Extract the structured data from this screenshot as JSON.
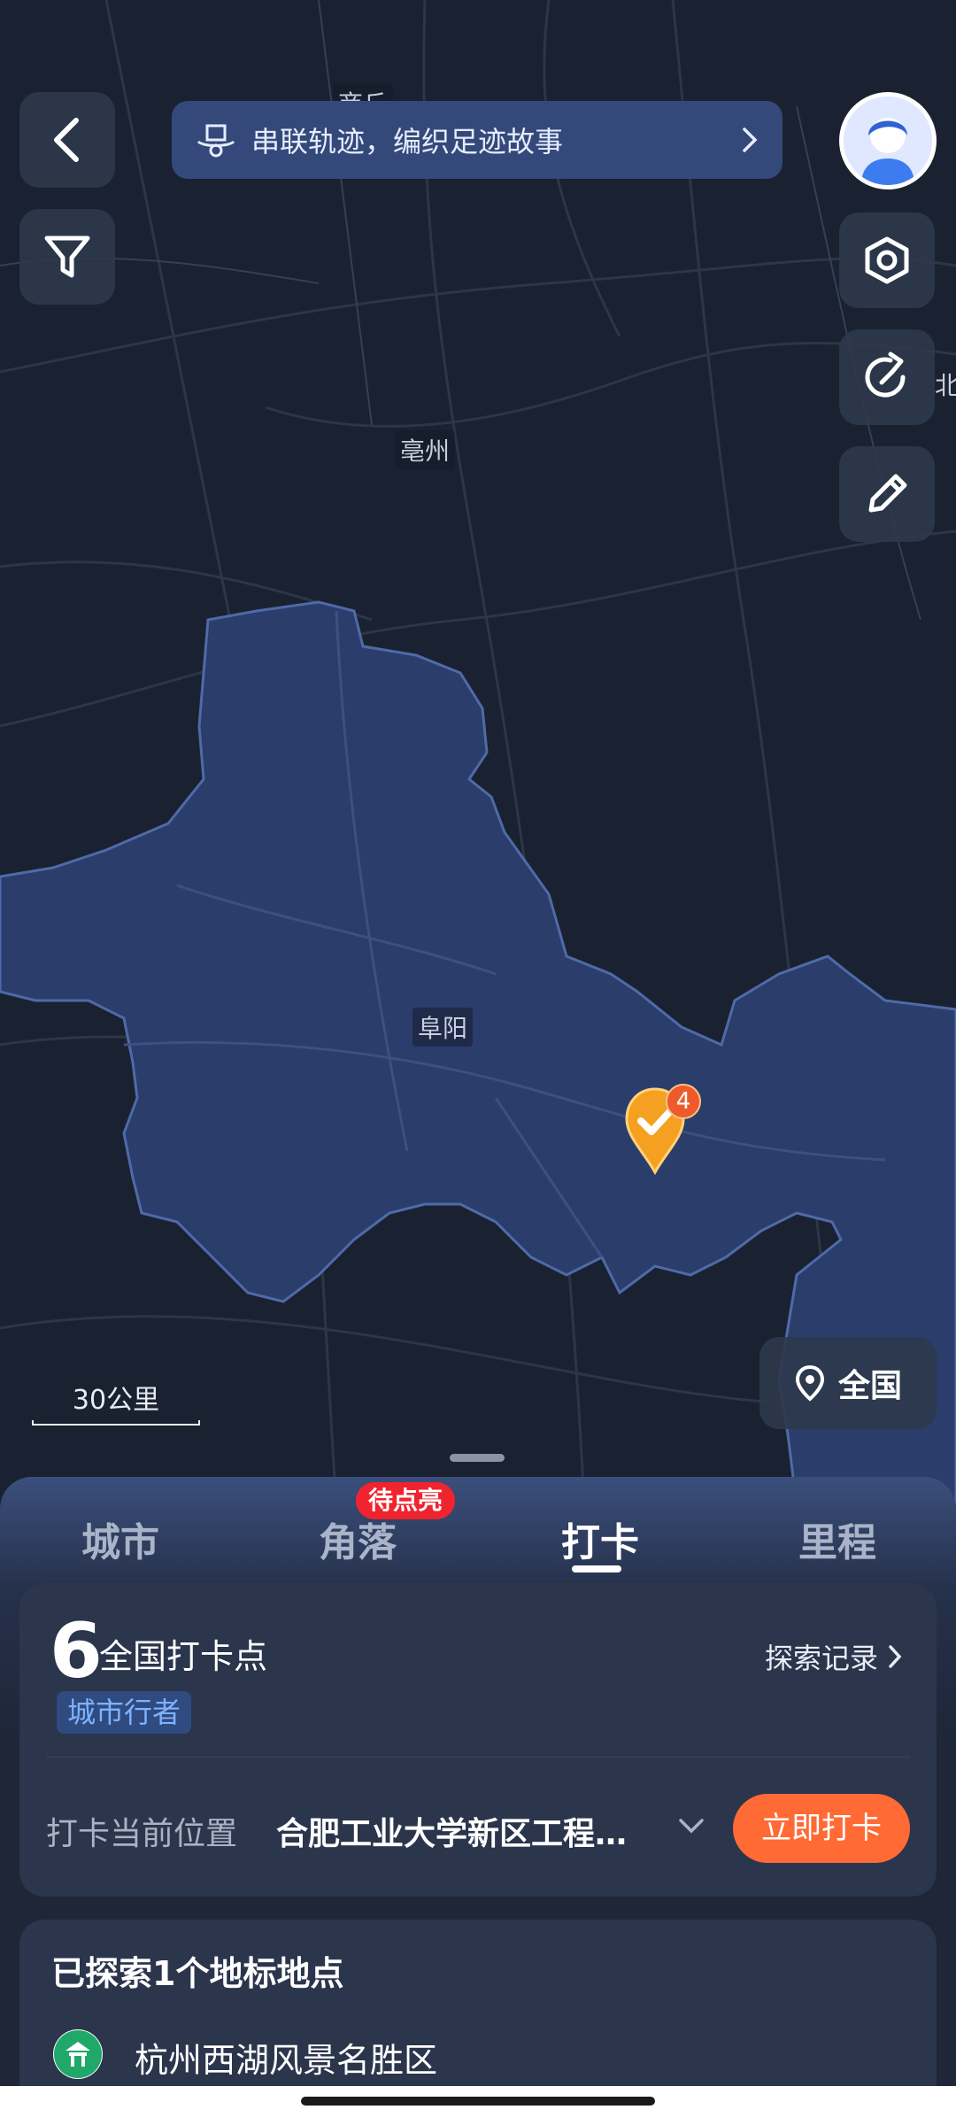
{
  "banner": {
    "text": "串联轨迹，编织足迹故事"
  },
  "map": {
    "labels": {
      "shangqiu": "商丘",
      "bozhou": "亳州",
      "fuyang": "阜阳",
      "north_partial": "北"
    },
    "marker_badge": "4",
    "scale": "30公里",
    "nation_button": "全国",
    "colors": {
      "background": "#1a2130",
      "region": "#2a3d6b",
      "region_border": "#4f6aa8",
      "marker": "#f5a020",
      "badge": "#ef5a2a"
    }
  },
  "tabs": {
    "items": [
      "城市",
      "角落",
      "打卡",
      "里程"
    ],
    "active": "打卡",
    "badge": "待点亮"
  },
  "checkin_card": {
    "count": "6",
    "title": "全国打卡点",
    "level": "城市行者",
    "explore_link": "探索记录",
    "current_location_label": "打卡当前位置",
    "current_location_value": "合肥工业大学新区工程…",
    "checkin_button": "立即打卡"
  },
  "landmark_card": {
    "title": "已探索1个地标地点",
    "items": [
      "杭州西湖风景名胜区"
    ]
  }
}
